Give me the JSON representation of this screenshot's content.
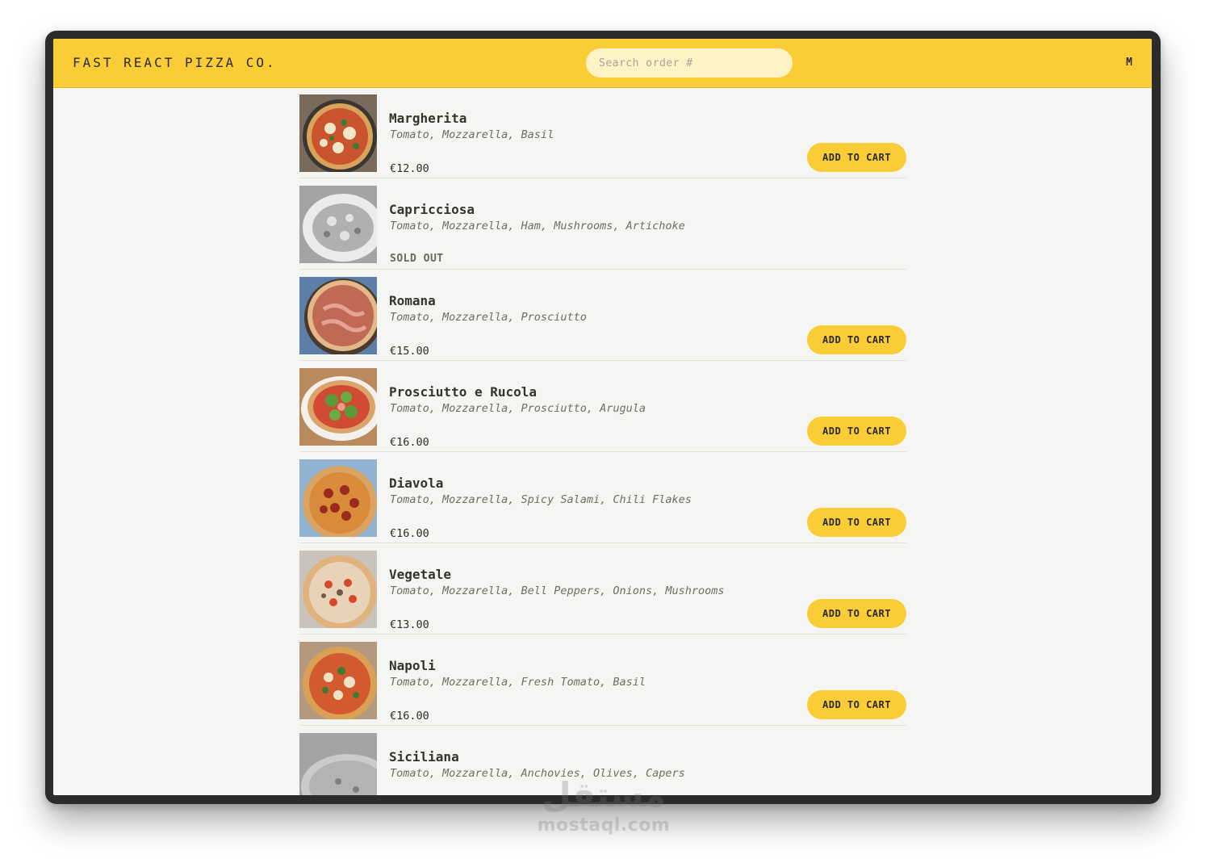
{
  "header": {
    "brand": "FAST REACT PIZZA CO.",
    "search_placeholder": "Search order #",
    "user_initial": "M"
  },
  "menu": {
    "add_label": "ADD TO CART",
    "sold_out_label": "SOLD OUT",
    "items": [
      {
        "name": "Margherita",
        "ingredients": "Tomato, Mozzarella, Basil",
        "price": "€12.00",
        "sold_out": false
      },
      {
        "name": "Capricciosa",
        "ingredients": "Tomato, Mozzarella, Ham, Mushrooms, Artichoke",
        "price": "",
        "sold_out": true
      },
      {
        "name": "Romana",
        "ingredients": "Tomato, Mozzarella, Prosciutto",
        "price": "€15.00",
        "sold_out": false
      },
      {
        "name": "Prosciutto e Rucola",
        "ingredients": "Tomato, Mozzarella, Prosciutto, Arugula",
        "price": "€16.00",
        "sold_out": false
      },
      {
        "name": "Diavola",
        "ingredients": "Tomato, Mozzarella, Spicy Salami, Chili Flakes",
        "price": "€16.00",
        "sold_out": false
      },
      {
        "name": "Vegetale",
        "ingredients": "Tomato, Mozzarella, Bell Peppers, Onions, Mushrooms",
        "price": "€13.00",
        "sold_out": false
      },
      {
        "name": "Napoli",
        "ingredients": "Tomato, Mozzarella, Fresh Tomato, Basil",
        "price": "€16.00",
        "sold_out": false
      },
      {
        "name": "Siciliana",
        "ingredients": "Tomato, Mozzarella, Anchovies, Olives, Capers",
        "price": "",
        "sold_out": true
      }
    ]
  },
  "watermark": {
    "arabic": "مستقل",
    "latin": "mostaql.com"
  },
  "colors": {
    "accent": "#facc36",
    "background": "#f5f5f4",
    "search_bg": "#fef3c4"
  }
}
